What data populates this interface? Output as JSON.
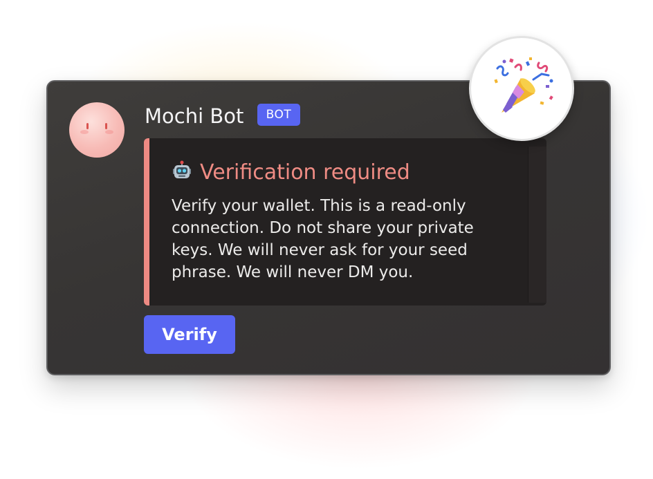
{
  "message": {
    "author": "Mochi Bot",
    "badge": "BOT"
  },
  "embed": {
    "icon": "robot-emoji",
    "title": "Verification required",
    "description": "Verify your wallet. This is a read-only connection. Do not share your private keys. We will never ask for your seed phrase. We will never DM you."
  },
  "actions": {
    "verify_label": "Verify"
  },
  "reaction": {
    "icon": "party-popper-emoji"
  },
  "colors": {
    "accent": "#5865f2",
    "embed_bar": "#ee8a83",
    "embed_title": "#ef8c84",
    "card_background": "#3a3837",
    "embed_background": "#242121",
    "avatar": "#f7bbb6"
  }
}
